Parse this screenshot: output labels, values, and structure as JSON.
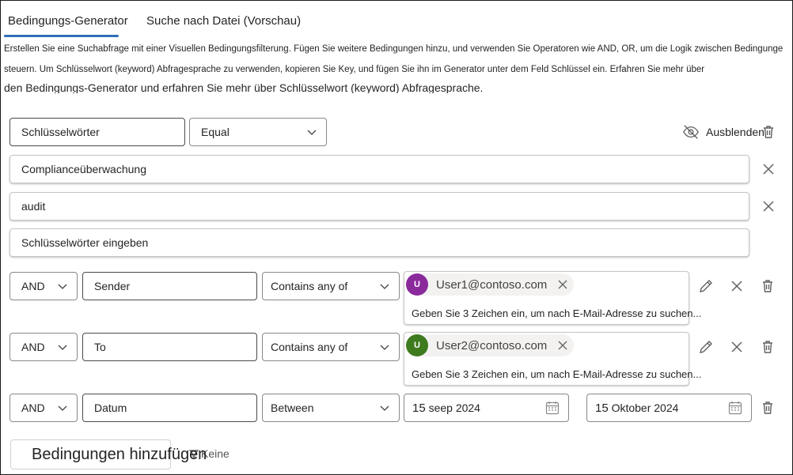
{
  "tabs": [
    {
      "label": "Bedingungs-Generator",
      "active": true
    },
    {
      "label": "Suche nach Datei (Vorschau)",
      "active": false
    }
  ],
  "description": {
    "line1": "Erstellen Sie eine Suchabfrage mit einer Visuellen Bedingungsfilterung. Fügen Sie weitere Bedingungen hinzu, und verwenden Sie Operatoren wie AND, OR, um die Logik zwischen Bedingungen zu",
    "line2": "steuern. Um Schlüsselwort (keyword) Abfragesprache zu verwenden, kopieren Sie Key, und fügen Sie ihn im Generator unter dem Feld Schlüssel ein. Erfahren Sie mehr über",
    "line3": "den Bedingungs-Generator und erfahren Sie mehr über Schlüsselwort (keyword) Abfragesprache."
  },
  "keywords": {
    "field": "Schlüsselwörter",
    "operator": "Equal",
    "hide_label": "Ausblenden",
    "values": [
      "Complianceüberwachung",
      "audit"
    ],
    "placeholder": "Schlüsselwörter eingeben"
  },
  "conditions": [
    {
      "logic": "AND",
      "field": "Sender",
      "operator": "Contains any of",
      "chip": {
        "initial": "U",
        "email": "User1@contoso.com",
        "color": "#8a2a9b"
      },
      "hint": "Geben Sie 3 Zeichen ein, um nach E-Mail-Adresse zu suchen..."
    },
    {
      "logic": "AND",
      "field": "To",
      "operator": "Contains any of",
      "chip": {
        "initial": "U",
        "email": "User2@contoso.com",
        "color": "#3e7b1f"
      },
      "hint": "Geben Sie 3 Zeichen ein, um nach E-Mail-Adresse zu suchen..."
    },
    {
      "logic": "AND",
      "field": "Datum",
      "operator": "Between",
      "start_day": "15",
      "start_month": "seep 2024",
      "end_day": "15",
      "end_month": "Oktober 2024"
    }
  ],
  "add_button": "Bedingungen hinzufügen",
  "overlap_label": "Keine",
  "colors": {
    "accent": "#2f6fb8",
    "text": "#242424",
    "icon": "#616161"
  }
}
